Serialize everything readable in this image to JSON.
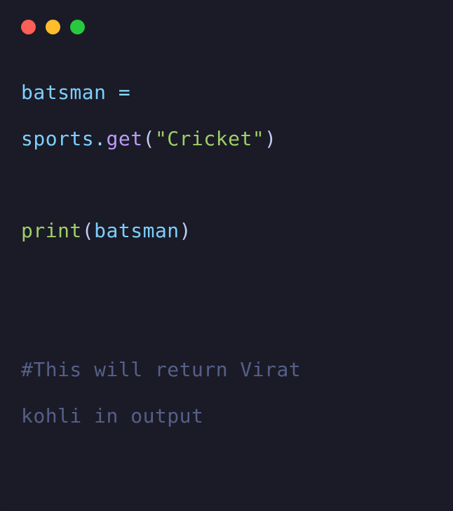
{
  "code": {
    "line1": {
      "var": "batsman",
      "op": " = "
    },
    "line2": {
      "obj": "sports",
      "dot": ".",
      "method": "get",
      "lparen": "(",
      "string": "\"Cricket\"",
      "rparen": ")"
    },
    "line3": {
      "func": "print",
      "lparen": "(",
      "arg": "batsman",
      "rparen": ")"
    },
    "comment1": "#This will return Virat ",
    "comment2": "kohli in output"
  }
}
